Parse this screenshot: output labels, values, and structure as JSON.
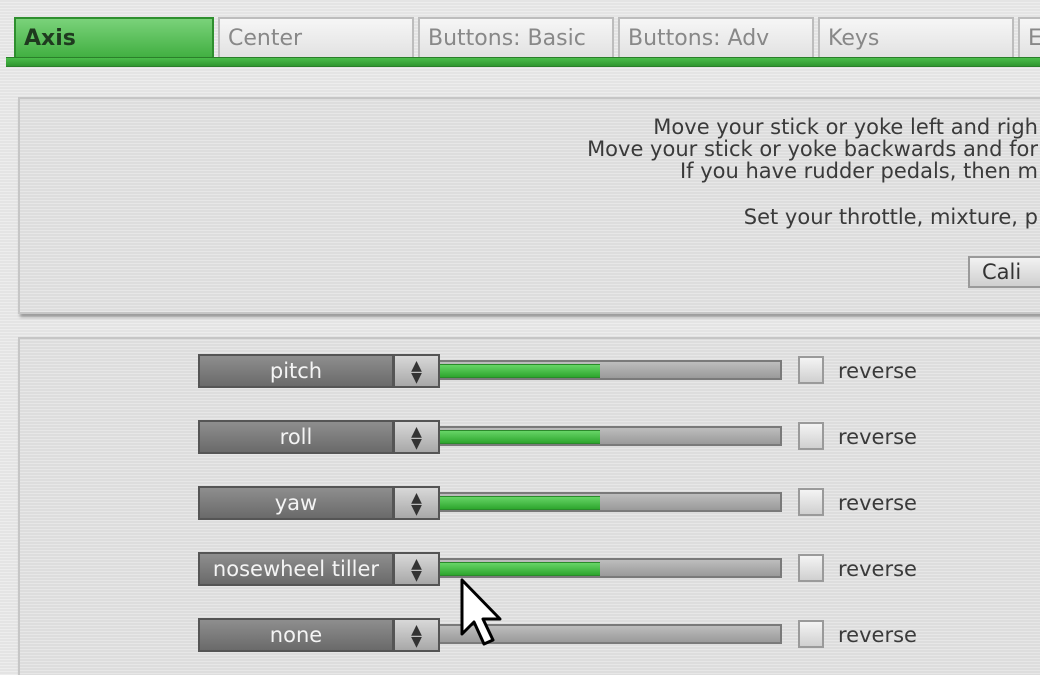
{
  "tabs": [
    {
      "label": "Axis",
      "active": true
    },
    {
      "label": "Center",
      "active": false
    },
    {
      "label": "Buttons: Basic",
      "active": false
    },
    {
      "label": "Buttons: Adv",
      "active": false
    },
    {
      "label": "Keys",
      "active": false
    },
    {
      "label": "E",
      "active": false
    }
  ],
  "instructions": {
    "line1": "Move your stick or yoke left and righ",
    "line2": "Move your stick or yoke backwards and for",
    "line3": "If you have rudder pedals, then m",
    "line4": "Set your throttle, mixture, p",
    "calibrate_label": "Cali"
  },
  "axes": [
    {
      "assignment": "pitch",
      "level": 0.47,
      "reverse_label": "reverse",
      "reverse_checked": false
    },
    {
      "assignment": "roll",
      "level": 0.47,
      "reverse_label": "reverse",
      "reverse_checked": false
    },
    {
      "assignment": "yaw",
      "level": 0.47,
      "reverse_label": "reverse",
      "reverse_checked": false
    },
    {
      "assignment": "nosewheel tiller",
      "level": 0.47,
      "reverse_label": "reverse",
      "reverse_checked": false
    },
    {
      "assignment": "none",
      "level": 0.0,
      "reverse_label": "reverse",
      "reverse_checked": false
    }
  ],
  "colors": {
    "accent_green": "#3fae3f",
    "panel_gray": "#dddddd",
    "select_gray": "#7a7a7a"
  },
  "icons": {
    "select_arrow": "up-down-arrow-icon",
    "cursor": "mouse-pointer-icon"
  }
}
